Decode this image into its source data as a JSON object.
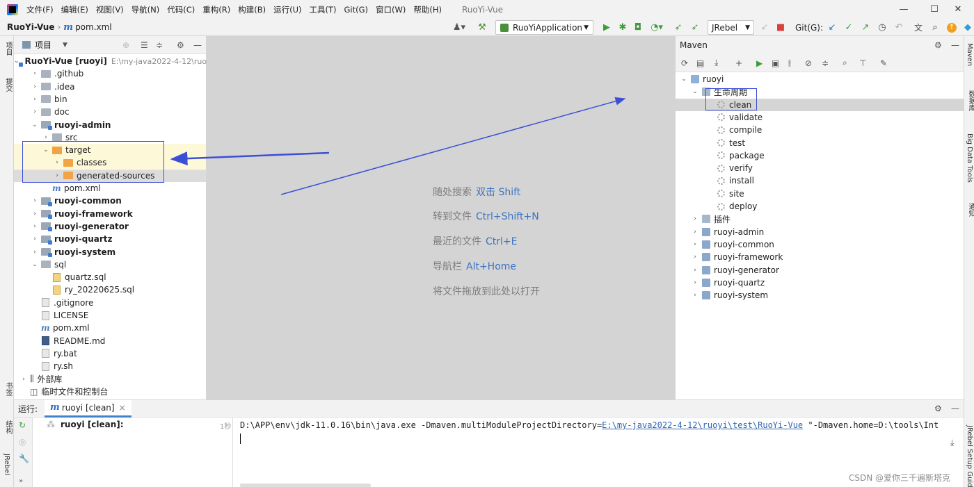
{
  "menubar": {
    "items": [
      "文件(F)",
      "编辑(E)",
      "视图(V)",
      "导航(N)",
      "代码(C)",
      "重构(R)",
      "构建(B)",
      "运行(U)",
      "工具(T)",
      "Git(G)",
      "窗口(W)",
      "帮助(H)"
    ],
    "window_title": "RuoYi-Vue",
    "minimize": "—",
    "maximize": "☐",
    "close": "✕"
  },
  "navbar": {
    "project": "RuoYi-Vue",
    "file": "pom.xml",
    "run_config": "RuoYiApplication",
    "jrebel": "JRebel",
    "git_label": "Git(G):"
  },
  "left_strip": {
    "project_label": "项目",
    "commit_label": "提交",
    "bookmark_label": "书签",
    "structure_label": "结构",
    "jrebel_label": "JRebel"
  },
  "right_strip": {
    "maven_label": "Maven",
    "db_label": "数据库",
    "bigdata_label": "Big Data Tools",
    "notify_label": "通知",
    "setup_label": "JRebel Setup Guide"
  },
  "project_panel": {
    "title": "项目",
    "tree": [
      {
        "arrow": "⌄",
        "icon": "mod",
        "label": "RuoYi-Vue [ruoyi]",
        "bold": true,
        "dim": "E:\\my-java2022-4-12\\ruoy",
        "indent": 0
      },
      {
        "arrow": "›",
        "icon": "folder",
        "label": ".github",
        "indent": 1
      },
      {
        "arrow": "›",
        "icon": "folder",
        "label": ".idea",
        "indent": 1
      },
      {
        "arrow": "›",
        "icon": "folder",
        "label": "bin",
        "indent": 1
      },
      {
        "arrow": "›",
        "icon": "folder",
        "label": "doc",
        "indent": 1
      },
      {
        "arrow": "⌄",
        "icon": "mod",
        "label": "ruoyi-admin",
        "bold": true,
        "indent": 1
      },
      {
        "arrow": "›",
        "icon": "folder",
        "label": "src",
        "indent": 2
      },
      {
        "arrow": "⌄",
        "icon": "orange",
        "label": "target",
        "indent": 2,
        "highlight": "yellow"
      },
      {
        "arrow": "›",
        "icon": "orange",
        "label": "classes",
        "indent": 3,
        "highlight": "yellow"
      },
      {
        "arrow": "›",
        "icon": "orange",
        "label": "generated-sources",
        "indent": 3,
        "highlight": "grey"
      },
      {
        "arrow": "",
        "icon": "m",
        "label": "pom.xml",
        "indent": 2
      },
      {
        "arrow": "›",
        "icon": "mod",
        "label": "ruoyi-common",
        "bold": true,
        "indent": 1
      },
      {
        "arrow": "›",
        "icon": "mod",
        "label": "ruoyi-framework",
        "bold": true,
        "indent": 1
      },
      {
        "arrow": "›",
        "icon": "mod",
        "label": "ruoyi-generator",
        "bold": true,
        "indent": 1
      },
      {
        "arrow": "›",
        "icon": "mod",
        "label": "ruoyi-quartz",
        "bold": true,
        "indent": 1
      },
      {
        "arrow": "›",
        "icon": "mod",
        "label": "ruoyi-system",
        "bold": true,
        "indent": 1
      },
      {
        "arrow": "⌄",
        "icon": "folder",
        "label": "sql",
        "indent": 1
      },
      {
        "arrow": "",
        "icon": "sql",
        "label": "quartz.sql",
        "indent": 2
      },
      {
        "arrow": "",
        "icon": "sql",
        "label": "ry_20220625.sql",
        "indent": 2
      },
      {
        "arrow": "",
        "icon": "file",
        "label": ".gitignore",
        "indent": 1
      },
      {
        "arrow": "",
        "icon": "file",
        "label": "LICENSE",
        "indent": 1
      },
      {
        "arrow": "",
        "icon": "m",
        "label": "pom.xml",
        "indent": 1
      },
      {
        "arrow": "",
        "icon": "md",
        "label": "README.md",
        "indent": 1
      },
      {
        "arrow": "",
        "icon": "file",
        "label": "ry.bat",
        "indent": 1
      },
      {
        "arrow": "",
        "icon": "file",
        "label": "ry.sh",
        "indent": 1
      },
      {
        "arrow": "›",
        "icon": "lib",
        "label": "外部库",
        "indent": 0
      },
      {
        "arrow": "",
        "icon": "scratch",
        "label": "临时文件和控制台",
        "indent": 0
      }
    ]
  },
  "editor": {
    "hints": [
      {
        "text": "随处搜索",
        "key": "双击 Shift"
      },
      {
        "text": "转到文件",
        "key": "Ctrl+Shift+N"
      },
      {
        "text": "最近的文件",
        "key": "Ctrl+E"
      },
      {
        "text": "导航栏",
        "key": "Alt+Home"
      },
      {
        "text": "将文件拖放到此处以打开",
        "key": ""
      }
    ]
  },
  "maven_panel": {
    "title": "Maven",
    "tree": [
      {
        "arrow": "⌄",
        "icon": "root",
        "label": "ruoyi",
        "indent": 0
      },
      {
        "arrow": "⌄",
        "icon": "lifecycle",
        "label": "生命周期",
        "indent": 1
      },
      {
        "arrow": "",
        "icon": "gear",
        "label": "clean",
        "indent": 2,
        "selected": true
      },
      {
        "arrow": "",
        "icon": "gear",
        "label": "validate",
        "indent": 2
      },
      {
        "arrow": "",
        "icon": "gear",
        "label": "compile",
        "indent": 2
      },
      {
        "arrow": "",
        "icon": "gear",
        "label": "test",
        "indent": 2
      },
      {
        "arrow": "",
        "icon": "gear",
        "label": "package",
        "indent": 2
      },
      {
        "arrow": "",
        "icon": "gear",
        "label": "verify",
        "indent": 2
      },
      {
        "arrow": "",
        "icon": "gear",
        "label": "install",
        "indent": 2
      },
      {
        "arrow": "",
        "icon": "gear",
        "label": "site",
        "indent": 2
      },
      {
        "arrow": "",
        "icon": "gear",
        "label": "deploy",
        "indent": 2
      },
      {
        "arrow": "›",
        "icon": "lifecycle",
        "label": "插件",
        "indent": 1
      },
      {
        "arrow": "›",
        "icon": "mvn",
        "label": "ruoyi-admin",
        "indent": 1
      },
      {
        "arrow": "›",
        "icon": "mvn",
        "label": "ruoyi-common",
        "indent": 1
      },
      {
        "arrow": "›",
        "icon": "mvn",
        "label": "ruoyi-framework",
        "indent": 1
      },
      {
        "arrow": "›",
        "icon": "mvn",
        "label": "ruoyi-generator",
        "indent": 1
      },
      {
        "arrow": "›",
        "icon": "mvn",
        "label": "ruoyi-quartz",
        "indent": 1
      },
      {
        "arrow": "›",
        "icon": "mvn",
        "label": "ruoyi-system",
        "indent": 1
      }
    ]
  },
  "run_panel": {
    "label": "运行:",
    "tab": "ruoyi [clean]",
    "tab_close": "×",
    "tree_item": "ruoyi [clean]:",
    "duration": "1秒",
    "console_prefix": "D:\\APP\\env\\jdk-11.0.16\\bin\\java.exe -Dmaven.multiModuleProjectDirectory=",
    "console_link": "E:\\my-java2022-4-12\\ruoyi\\test\\RuoYi-Vue",
    "console_suffix": " \"-Dmaven.home=D:\\tools\\Int"
  },
  "watermark": "CSDN @爱你三千遍斯塔克"
}
